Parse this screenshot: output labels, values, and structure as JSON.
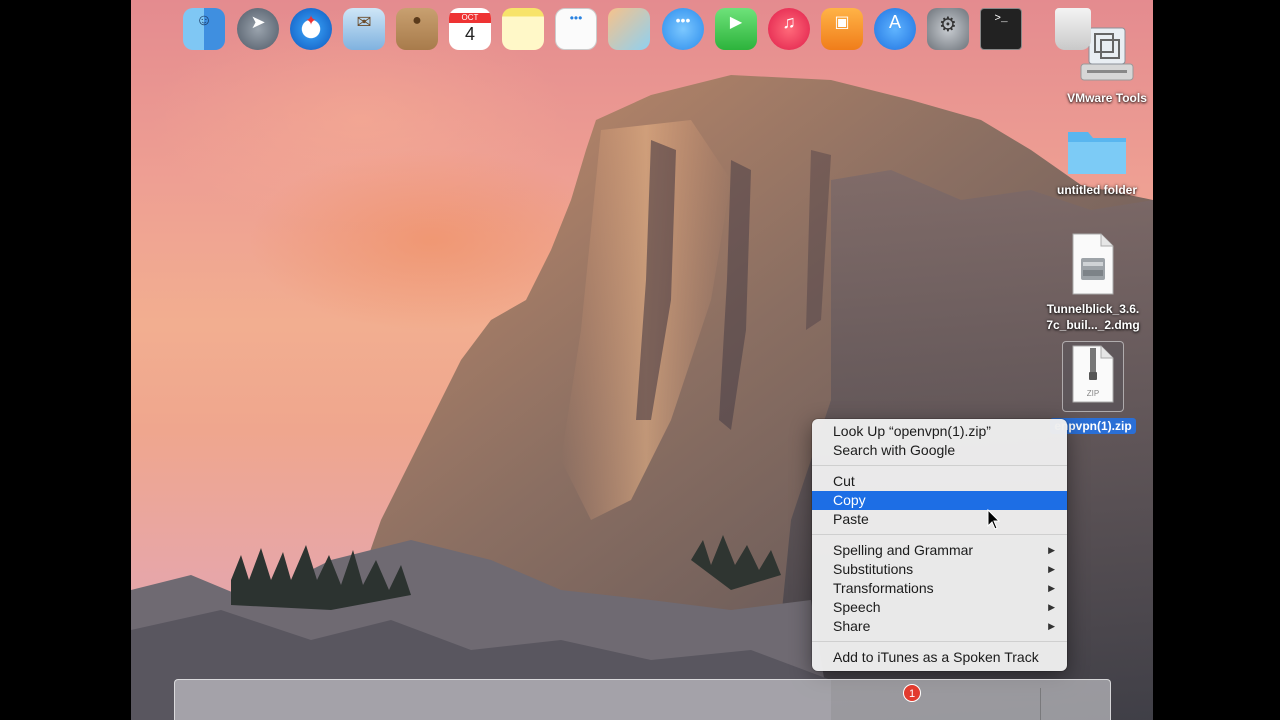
{
  "desktop": {
    "icons": [
      {
        "label": "VMware Tools",
        "icon": "disk-image-icon"
      },
      {
        "label": "untitled folder",
        "icon": "folder-icon"
      },
      {
        "label": "Tunnelblick_3.6.\n7c_buil..._2.dmg",
        "icon": "dmg-file-icon"
      },
      {
        "label": "enpvpn(1).zip",
        "icon": "zip-file-icon"
      }
    ]
  },
  "context_menu": {
    "items": [
      {
        "label": "Look Up “openvpn(1).zip”"
      },
      {
        "label": "Search with Google"
      },
      {
        "label": "Cut"
      },
      {
        "label": "Copy",
        "highlighted": true
      },
      {
        "label": "Paste"
      },
      {
        "label": "Spelling and Grammar",
        "submenu": true
      },
      {
        "label": "Substitutions",
        "submenu": true
      },
      {
        "label": "Transformations",
        "submenu": true
      },
      {
        "label": "Speech",
        "submenu": true
      },
      {
        "label": "Share",
        "submenu": true
      },
      {
        "label": "Add to iTunes as a Spoken Track"
      }
    ],
    "highlight_color": "#1d6ee5"
  },
  "dock": {
    "apps": [
      {
        "name": "finder-icon"
      },
      {
        "name": "launchpad-icon"
      },
      {
        "name": "safari-icon"
      },
      {
        "name": "mail-icon"
      },
      {
        "name": "contacts-icon"
      },
      {
        "name": "calendar-icon",
        "month": "OCT",
        "day": "4"
      },
      {
        "name": "notes-icon"
      },
      {
        "name": "reminders-icon"
      },
      {
        "name": "photo-icon"
      },
      {
        "name": "messages-icon"
      },
      {
        "name": "facetime-icon"
      },
      {
        "name": "itunes-icon"
      },
      {
        "name": "ibooks-icon"
      },
      {
        "name": "app-store-icon",
        "badge": "1"
      },
      {
        "name": "system-preferences-icon"
      },
      {
        "name": "terminal-icon"
      },
      {
        "name": "trash-icon"
      }
    ]
  }
}
